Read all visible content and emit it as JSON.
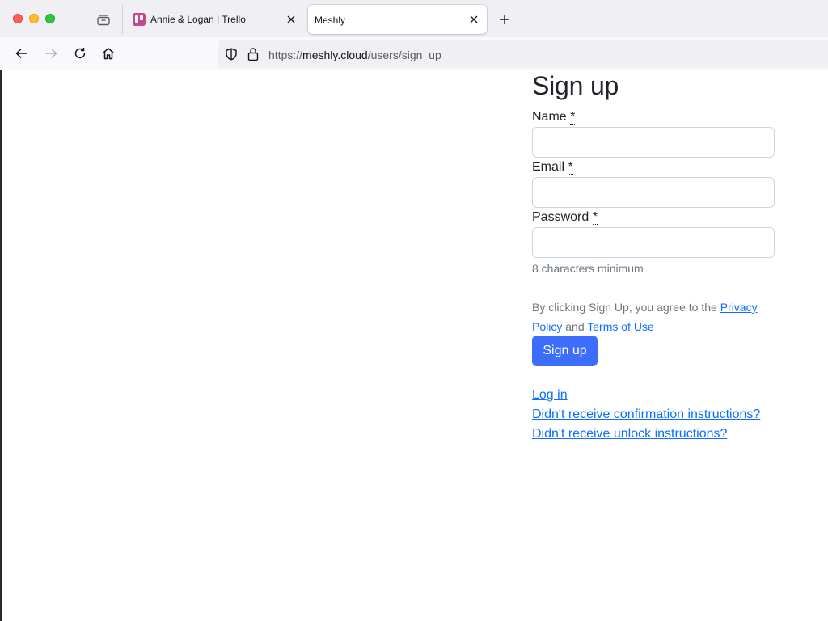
{
  "browser": {
    "tabs": [
      {
        "title": "Annie & Logan | Trello",
        "active": false,
        "favicon": "trello-icon"
      },
      {
        "title": "Meshly",
        "active": true
      }
    ],
    "url": {
      "scheme": "https://",
      "host": "meshly.cloud",
      "path": "/users/sign_up"
    },
    "icons": {
      "tab_overview": "tab-overview-icon",
      "new_tab": "plus-icon",
      "back": "back-arrow-icon",
      "forward": "forward-arrow-icon",
      "reload": "reload-icon",
      "home": "home-icon",
      "shield": "shield-icon",
      "lock": "lock-icon"
    }
  },
  "form": {
    "title": "Sign up",
    "fields": {
      "name": {
        "label": "Name",
        "required_mark": "*",
        "value": ""
      },
      "email": {
        "label": "Email",
        "required_mark": "*",
        "value": ""
      },
      "password": {
        "label": "Password",
        "required_mark": "*",
        "value": "",
        "hint": "8 characters minimum"
      }
    },
    "agreement": {
      "prefix": "By clicking Sign Up, you agree to the ",
      "privacy_link": "Privacy Policy",
      "middle": " and ",
      "terms_link": "Terms of Use"
    },
    "submit_label": "Sign up",
    "links": {
      "login": "Log in",
      "confirmation": "Didn't receive confirmation instructions?",
      "unlock": "Didn't receive unlock instructions?"
    }
  },
  "colors": {
    "primary_button": "#3d6dfb",
    "link": "#0d6efd",
    "muted_text": "#6c757d"
  }
}
